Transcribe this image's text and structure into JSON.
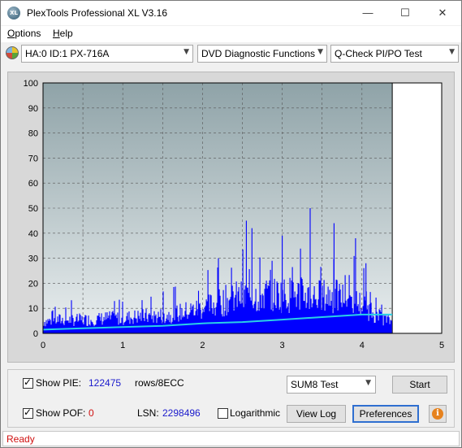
{
  "window": {
    "title": "PlexTools Professional XL V3.16",
    "app_icon_text": "XL",
    "controls": {
      "minimize": "—",
      "maximize": "☐",
      "close": "✕"
    }
  },
  "menu": {
    "items": [
      {
        "label": "Options",
        "underline": "O",
        "rest": "ptions"
      },
      {
        "label": "Help",
        "underline": "H",
        "rest": "elp"
      }
    ]
  },
  "toolbar": {
    "drive": "HA:0 ID:1  PX-716A",
    "function": "DVD Diagnostic Functions",
    "test": "Q-Check PI/PO Test"
  },
  "chart_data": {
    "type": "bar",
    "title": "",
    "xlabel": "",
    "ylabel": "",
    "xlim": [
      0,
      5
    ],
    "ylim": [
      0,
      100
    ],
    "x_ticks": [
      "0",
      "1",
      "2",
      "3",
      "4",
      "5"
    ],
    "y_ticks": [
      "0",
      "10",
      "20",
      "30",
      "40",
      "50",
      "60",
      "70",
      "80",
      "90",
      "100"
    ],
    "grid": true,
    "scan_end_x": 4.38,
    "series": [
      {
        "name": "PIE",
        "color": "#0000ff",
        "x": [
          0.0,
          0.2,
          0.4,
          0.6,
          0.8,
          1.0,
          1.2,
          1.4,
          1.6,
          1.8,
          2.0,
          2.2,
          2.4,
          2.6,
          2.8,
          3.0,
          3.2,
          3.4,
          3.6,
          3.8,
          4.0,
          4.2,
          4.38
        ],
        "values": [
          7,
          8,
          8,
          8,
          9,
          9,
          10,
          10,
          11,
          13,
          15,
          18,
          21,
          22,
          23,
          23,
          23,
          22,
          22,
          21,
          17,
          10,
          7
        ],
        "peaks": [
          {
            "x": 2.55,
            "y": 45
          },
          {
            "x": 2.62,
            "y": 42
          },
          {
            "x": 3.35,
            "y": 50
          },
          {
            "x": 3.65,
            "y": 44
          },
          {
            "x": 3.0,
            "y": 39
          },
          {
            "x": 2.2,
            "y": 30
          },
          {
            "x": 3.92,
            "y": 38
          },
          {
            "x": 1.95,
            "y": 17
          },
          {
            "x": 4.05,
            "y": 28
          }
        ]
      },
      {
        "name": "PIE sum trend",
        "color": "#2ad0e6",
        "x": [
          0.0,
          0.5,
          1.0,
          1.5,
          2.0,
          2.5,
          3.0,
          3.5,
          4.0,
          4.38
        ],
        "values": [
          1.5,
          2,
          2.5,
          3,
          4,
          4.5,
          5.5,
          6.5,
          7.5,
          7.5
        ]
      }
    ]
  },
  "bottom": {
    "show_pie_label": "Show PIE:",
    "show_pie_checked": true,
    "pie_value": "122475",
    "pie_unit": "rows/8ECC",
    "show_pof_label": "Show POF:",
    "show_pof_checked": true,
    "pof_value": "0",
    "lsn_label": "LSN:",
    "lsn_value": "2298496",
    "logarithmic_label": "Logarithmic",
    "logarithmic_checked": false,
    "test_select": "SUM8 Test",
    "start_button": "Start",
    "view_log_button": "View Log",
    "preferences_button": "Preferences",
    "info_icon": "i"
  },
  "status": {
    "text": "Ready"
  }
}
